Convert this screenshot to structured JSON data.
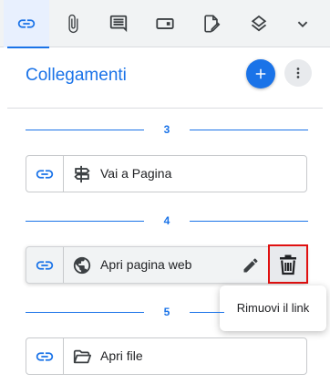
{
  "tabs": [
    {
      "name": "link-icon",
      "active": true
    },
    {
      "name": "paperclip-icon",
      "active": false
    },
    {
      "name": "comment-icon",
      "active": false
    },
    {
      "name": "form-field-icon",
      "active": false
    },
    {
      "name": "signature-file-icon",
      "active": false
    },
    {
      "name": "layers-icon",
      "active": false
    },
    {
      "name": "chevron-down-icon",
      "active": false
    }
  ],
  "header": {
    "title": "Collegamenti",
    "add_icon": "plus-icon",
    "more_icon": "more-vertical-icon"
  },
  "pages": [
    {
      "number": "3",
      "links": [
        {
          "label": "Vai a Pagina",
          "type_icon": "signpost-icon"
        }
      ]
    },
    {
      "number": "4",
      "links": [
        {
          "label": "Apri pagina web",
          "type_icon": "globe-icon",
          "hover": true
        }
      ]
    },
    {
      "number": "5",
      "links": [
        {
          "label": "Apri file",
          "type_icon": "folder-open-icon"
        }
      ]
    }
  ],
  "tooltip": {
    "text": "Rimuovi il link"
  },
  "colors": {
    "accent": "#1a73e8",
    "highlight_border": "#e01010",
    "tab_bg": "#f1f3f4"
  }
}
